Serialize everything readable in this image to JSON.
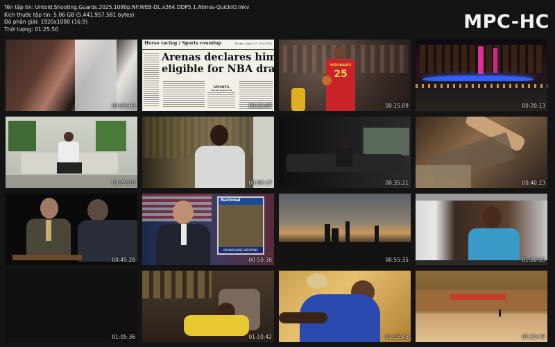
{
  "header": {
    "filename": "Tên tập tin: Untold.Shooting.Guards.2025.1080p.NF.WEB-DL.x264.DDP5.1.Atmos-QuickIO.mkv",
    "filesize": "Kích thước tập tin: 5.06 GB (5,441,957,581 bytes)",
    "resolution": "Độ phân giải: 1920x1080 (16:9)",
    "duration": "Thời lượng: 01:25:50"
  },
  "brand": "MPC-HC",
  "thumbnails": [
    {
      "timestamp": "00:05:03"
    },
    {
      "timestamp": "00:10:07",
      "newspaper_section": "Horse racing / Sports roundup",
      "newspaper_date": "Friday, April 19, 2002 B20",
      "headline_line1": "Arenas declares himself",
      "headline_line2": "eligible for NBA draft",
      "subhead": "SPORTS ROUNDUP"
    },
    {
      "timestamp": "00:15:09",
      "jersey": "MCDONALD'S",
      "jersey_number": "25"
    },
    {
      "timestamp": "00:20:13"
    },
    {
      "timestamp": "00:25:16"
    },
    {
      "timestamp": "00:30:17"
    },
    {
      "timestamp": "00:35:21"
    },
    {
      "timestamp": "00:40:23"
    },
    {
      "timestamp": "00:45:28"
    },
    {
      "timestamp": "00:50:30",
      "news_label": "National",
      "news_caption": "BRANDISHING WEAPONS"
    },
    {
      "timestamp": "00:55:35"
    },
    {
      "timestamp": "01:00:33"
    },
    {
      "timestamp": "01:05:36"
    },
    {
      "timestamp": "01:10:42"
    },
    {
      "timestamp": "01:15:48"
    },
    {
      "timestamp": "01:20:45"
    }
  ]
}
